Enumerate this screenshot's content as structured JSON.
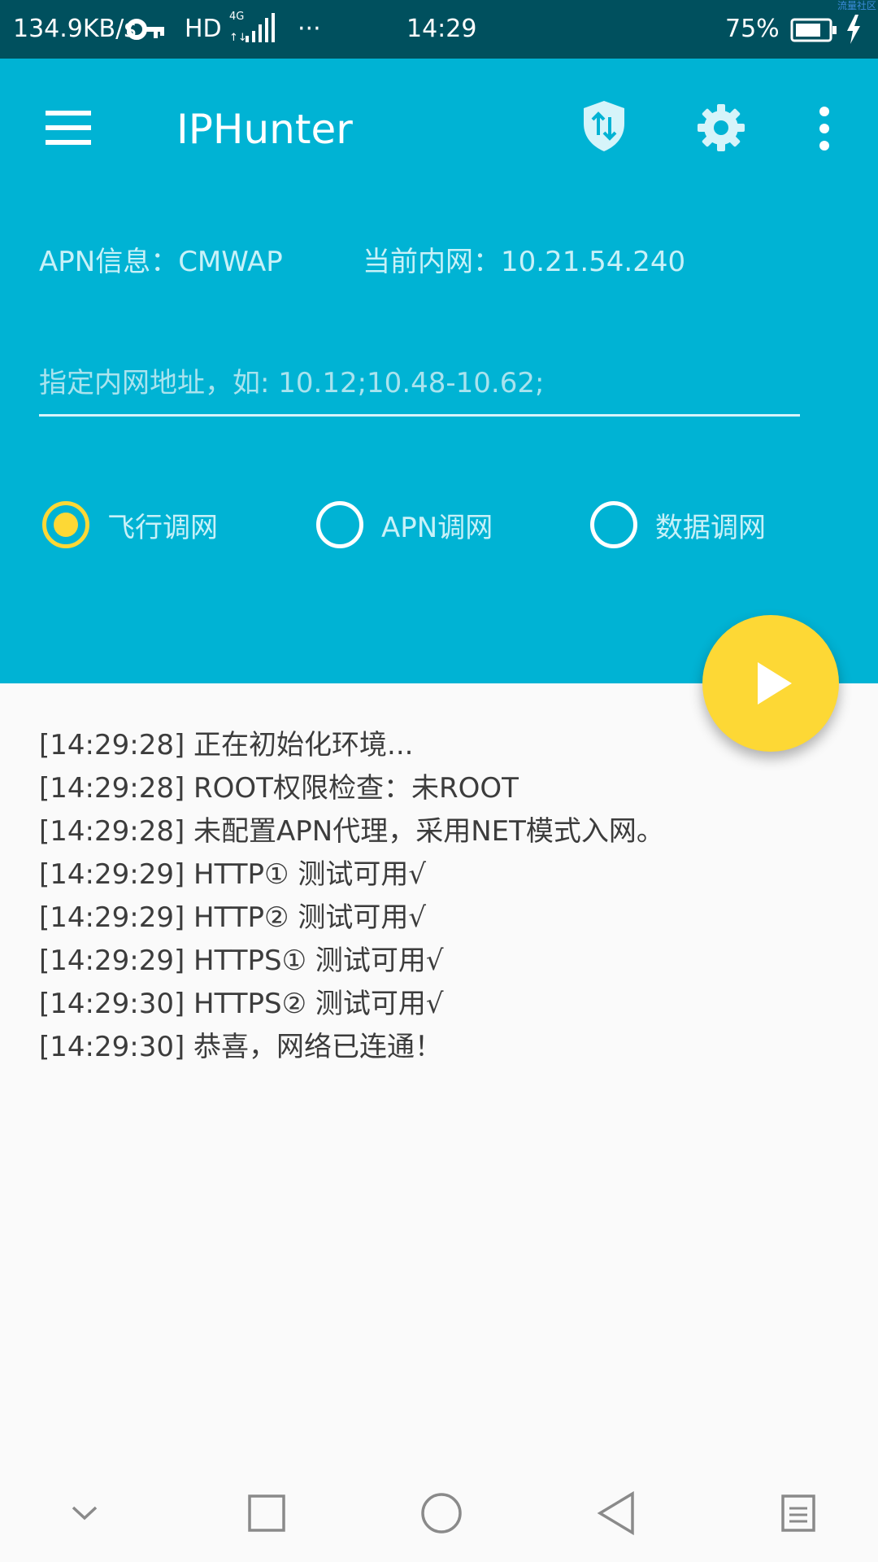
{
  "status_bar": {
    "net_speed": "134.9KB/s",
    "hd": "HD",
    "network_type": "4G",
    "more": "···",
    "time": "14:29",
    "battery": "75%",
    "icons": [
      "key-icon",
      "signal-icon",
      "battery-icon",
      "charging-icon"
    ]
  },
  "watermark": "流量社区",
  "toolbar": {
    "title": "IPHunter",
    "icons": [
      "menu-icon",
      "vpn-shield-icon",
      "settings-icon",
      "overflow-menu-icon"
    ]
  },
  "info": {
    "apn": "APN信息：CMWAP",
    "lan_ip": "当前内网：10.21.54.240"
  },
  "ip_input": {
    "value": "",
    "placeholder": "指定内网地址，如: 10.12;10.48-10.62;"
  },
  "modes": {
    "selected": "airplane",
    "options": [
      {
        "id": "airplane",
        "label": "飞行调网"
      },
      {
        "id": "apn",
        "label": "APN调网"
      },
      {
        "id": "data",
        "label": "数据调网"
      }
    ]
  },
  "fab": {
    "icon": "play-icon"
  },
  "log": [
    "[14:29:28] 正在初始化环境...",
    "[14:29:28] ROOT权限检查：未ROOT",
    "[14:29:28] 未配置APN代理，采用NET模式入网。",
    "[14:29:29] HTTP①   测试可用√",
    "[14:29:29] HTTP②   测试可用√",
    "[14:29:29] HTTPS① 测试可用√",
    "[14:29:30] HTTPS② 测试可用√",
    "[14:29:30] 恭喜，网络已连通！"
  ],
  "nav_bar": {
    "icons": [
      "chevron-down-icon",
      "recents-icon",
      "home-icon",
      "back-icon",
      "menu-list-icon"
    ]
  },
  "colors": {
    "status_bar": "#00505e",
    "primary": "#00b3d4",
    "accent": "#fdd835",
    "background": "#fafafa"
  }
}
